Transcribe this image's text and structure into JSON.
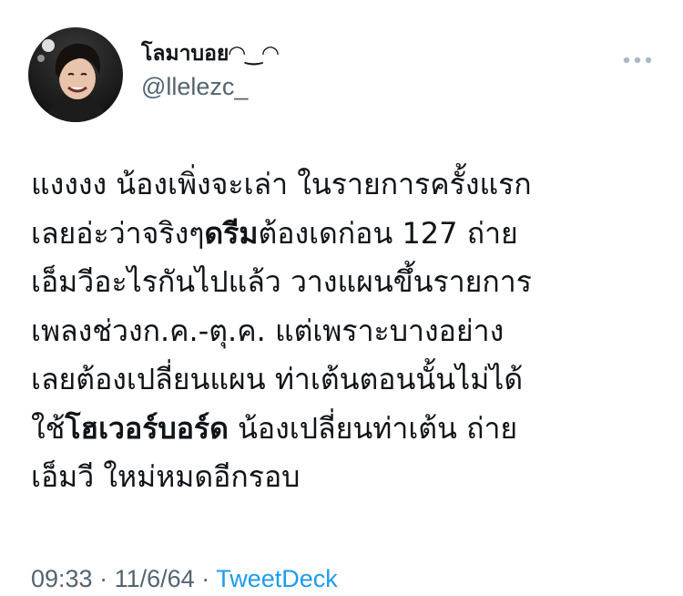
{
  "user": {
    "display_name": "โลมาบอย◠‿◠",
    "handle": "@llelezc_"
  },
  "tweet": {
    "lines": [
      [
        {
          "t": "แงงงง น้องเพิ่งจะเล่า ในรายการครั้งแรก",
          "b": false
        }
      ],
      [
        {
          "t": "เลยอ่ะว่าจริงๆ",
          "b": false
        },
        {
          "t": "ดรีม",
          "b": true
        },
        {
          "t": "ต้องเดก่อน 127 ถ่าย",
          "b": false
        }
      ],
      [
        {
          "t": "เอ็มวีอะไรกันไปแล้ว วางแผนขึ้นรายการ",
          "b": false
        }
      ],
      [
        {
          "t": "เพลงช่วงก.ค.-ตุ.ค. แต่เพราะบางอย่าง",
          "b": false
        }
      ],
      [
        {
          "t": "เลยต้องเปลี่ยนแผน ท่าเต้นตอนนั้นไม่ได้",
          "b": false
        }
      ],
      [
        {
          "t": "ใช้",
          "b": false
        },
        {
          "t": "โฮเวอร์บอร์ด",
          "b": true
        },
        {
          "t": " น้องเปลี่ยนท่าเต้น ถ่าย",
          "b": false
        }
      ],
      [
        {
          "t": "เอ็มวี ใหม่หมดอีกรอบ",
          "b": false
        }
      ]
    ]
  },
  "meta": {
    "time": "09:33",
    "separator": "·",
    "date": "11/6/64",
    "source": "TweetDeck"
  },
  "colors": {
    "text": "#0f1419",
    "secondary": "#536471",
    "link": "#1d9bf0",
    "more_dots": "#aab8c2"
  },
  "icons": {
    "more": "more-horizontal-icon"
  }
}
